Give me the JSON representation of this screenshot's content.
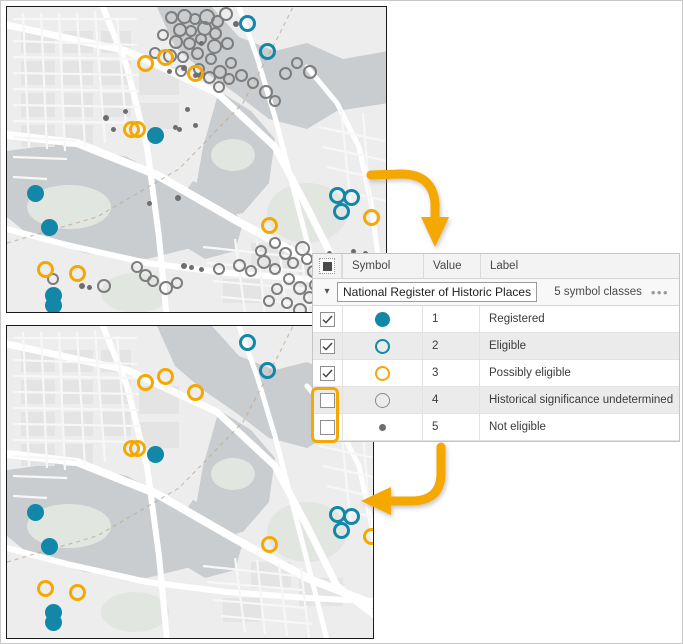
{
  "symbology": {
    "columns": {
      "check": "",
      "symbol": "Symbol",
      "value": "Value",
      "label": "Label"
    },
    "group": {
      "name": "National Register of Historic Places",
      "class_count_text": "5 symbol classes",
      "chevron": "chevron-down-icon",
      "more_menu": "•••"
    },
    "rows": [
      {
        "checked": true,
        "symbol": "filled-circle-teal",
        "value": "1",
        "label": "Registered"
      },
      {
        "checked": true,
        "symbol": "hollow-circle-teal",
        "value": "2",
        "label": "Eligible"
      },
      {
        "checked": true,
        "symbol": "hollow-circle-orange",
        "value": "3",
        "label": "Possibly eligible"
      },
      {
        "checked": false,
        "symbol": "hollow-circle-gray",
        "value": "4",
        "label": "Historical significance undetermined"
      },
      {
        "checked": false,
        "symbol": "small-dot-gray",
        "value": "5",
        "label": "Not eligible"
      }
    ]
  },
  "colors": {
    "teal": "#1287a8",
    "orange": "#f5a800",
    "gray": "#7d7d7d",
    "gray_dot": "#6e6e6e",
    "map_land": "#ededed",
    "map_water": "#c9cdcf",
    "map_road": "#ffffff",
    "panel_header": "#f3f3f3",
    "row_alt": "#ebebeb"
  },
  "maps": {
    "top": {
      "name": "map-before",
      "visible_classes": [
        "1",
        "2",
        "3",
        "4",
        "5"
      ]
    },
    "bottom": {
      "name": "map-after",
      "visible_classes": [
        "1",
        "2",
        "3"
      ]
    }
  },
  "annotations": {
    "arrow_top": "curved-arrow-down",
    "arrow_bottom": "curved-arrow-left",
    "checkbox_highlight": "orange-highlight-box"
  }
}
